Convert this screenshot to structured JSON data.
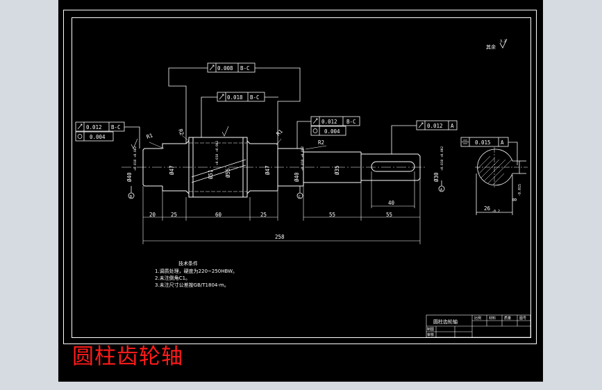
{
  "caption": "圆柱齿轮轴",
  "roughness_note": "其余",
  "roughness_value": "3.2",
  "tolerance_frames": {
    "runout_left_mid": {
      "value": "0.008",
      "datum": "B-C"
    },
    "runout_center": {
      "value": "0.018",
      "datum": "B-C"
    },
    "left_bearing_runout": {
      "value": "0.012",
      "datum": "B-C"
    },
    "left_bearing_cyl": {
      "value": "0.004"
    },
    "right_bearing_runout": {
      "value": "0.012",
      "datum": "B-C"
    },
    "right_bearing_cyl": {
      "value": "0.004"
    },
    "shaft_end_runout": {
      "value": "0.012",
      "datum": "A"
    },
    "keyway_symmetry": {
      "value": "0.015",
      "datum": "A"
    }
  },
  "radius_labels": [
    "R1",
    "R2",
    "R1",
    "R2"
  ],
  "diameter_labels": [
    "Ø40",
    "Ø47",
    "Ø51",
    "Ø55",
    "Ø47",
    "Ø40",
    "Ø35",
    "Ø30"
  ],
  "small_fits": [
    "+0.018 +0.002",
    "+0.018 +0.002",
    "+0.018 +0.002",
    "+0.018 +0.002"
  ],
  "dimensions": {
    "d20": "20",
    "d25a": "25",
    "d60": "60",
    "d25b": "25",
    "d55a": "55",
    "d55b": "55",
    "d40": "40",
    "d258": "258",
    "d26": "26",
    "d26_tol": "-0.2",
    "d8": "8",
    "d8_tol": "-0.015"
  },
  "datum_letters": [
    "B",
    "C",
    "A"
  ],
  "tech_notes": {
    "title": "技术条件",
    "lines": [
      "1.调质处理，硬度为220~250HBW。",
      "2.未注倒角C1。",
      "3.未注尺寸公差按GB/T1804-m。"
    ]
  },
  "title_block": {
    "part_name": "圆柱齿轮轴",
    "headers": [
      "比例",
      "材料",
      "质量",
      "图号"
    ],
    "row_labels": [
      "制图",
      "审核"
    ]
  }
}
